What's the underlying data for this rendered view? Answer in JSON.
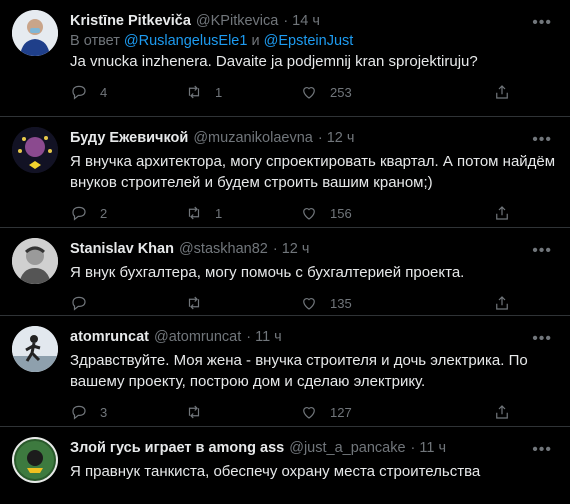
{
  "colors": {
    "background": "#000000",
    "accent": "#1d9bf0",
    "muted": "#71767b",
    "divider": "#2f3336"
  },
  "tweets": [
    {
      "name": "Kristīne Pitkeviča",
      "handle": "@KPitkevica",
      "time": "· 14 ч",
      "reply_prefix": "В ответ",
      "reply_user1": "@RuslangelusEle1",
      "reply_and": "и",
      "reply_user2": "@EpsteinJust",
      "text": "Ja vnucka inzhenera. Davaite ja podjemnij kran sprojektiruju?",
      "replies": "4",
      "retweets": "1",
      "likes": "253"
    },
    {
      "name": "Буду Ежевичкой",
      "handle": "@muzanikolaevna",
      "time": "· 12 ч",
      "text": "Я внучка архитектора, могу спроектировать квартал. А потом найдём внуков строителей и будем строить вашим краном;)",
      "replies": "2",
      "retweets": "1",
      "likes": "156"
    },
    {
      "name": "Stanislav Khan",
      "handle": "@staskhan82",
      "time": "· 12 ч",
      "text": "Я внук бухгалтера, могу помочь с бухгалтерией проекта.",
      "replies": "",
      "retweets": "",
      "likes": "135"
    },
    {
      "name": "atomruncat",
      "handle": "@atomruncat",
      "time": "· 11 ч",
      "text": "Здравствуйте. Моя жена - внучка строителя и дочь электрика. По вашему проекту, построю дом и сделаю электрику.",
      "replies": "3",
      "retweets": "",
      "likes": "127"
    },
    {
      "name": "Злой гусь играет в among ass",
      "handle": "@just_a_pancake",
      "time": "· 11 ч",
      "text": "Я правнук танкиста, обеспечу охрану места строительства"
    }
  ]
}
